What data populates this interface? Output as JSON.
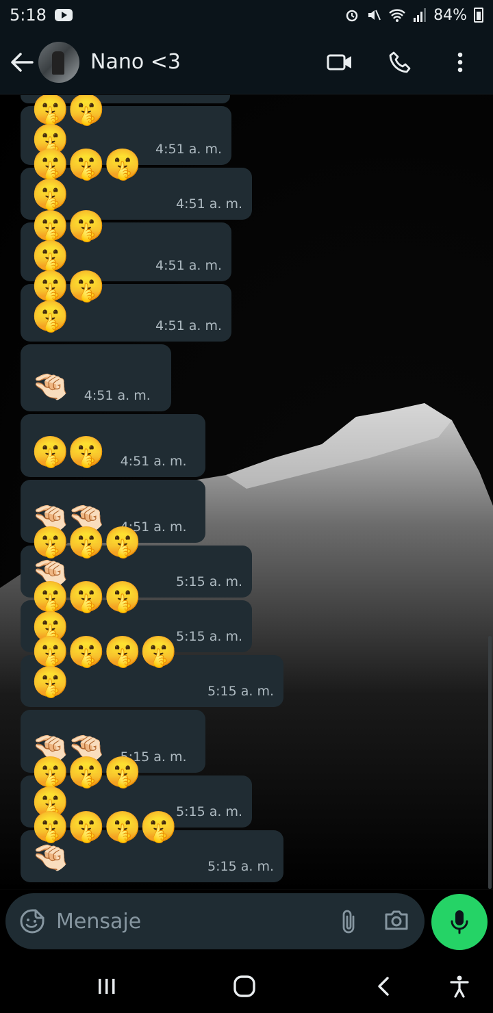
{
  "status": {
    "time": "5:18",
    "battery": "84%"
  },
  "header": {
    "contact_name": "Nano <3"
  },
  "messages": [
    {
      "emojis": "🤫🤫🤫",
      "time": "4:51 a. m."
    },
    {
      "emojis": "🤫🤫🤫🤫",
      "time": "4:51 a. m."
    },
    {
      "emojis": "🤫🤫🤫",
      "time": "4:51 a. m."
    },
    {
      "emojis": "🤫🤫🤫",
      "time": "4:51 a. m."
    },
    {
      "emojis": "🤏🏻",
      "time": "4:51 a. m."
    },
    {
      "emojis": "🤫🤫",
      "time": "4:51 a. m."
    },
    {
      "emojis": "🤏🏻🤏🏻",
      "time": "4:51 a. m."
    },
    {
      "emojis": "🤫🤫🤫🤏🏻",
      "time": "5:15 a. m."
    },
    {
      "emojis": "🤫🤫🤫🤫",
      "time": "5:15 a. m."
    },
    {
      "emojis": "🤫🤫🤫🤫🤫",
      "time": "5:15 a. m."
    },
    {
      "emojis": "🤏🏻🤏🏻",
      "time": "5:15 a. m."
    },
    {
      "emojis": "🤫🤫🤫🤫",
      "time": "5:15 a. m."
    },
    {
      "emojis": "🤫🤫🤫🤫🤏🏻",
      "time": "5:15 a. m."
    }
  ],
  "input": {
    "placeholder": "Mensaje"
  },
  "colors": {
    "accent": "#25d366",
    "bubble": "#202c33",
    "header": "#0b141a"
  }
}
